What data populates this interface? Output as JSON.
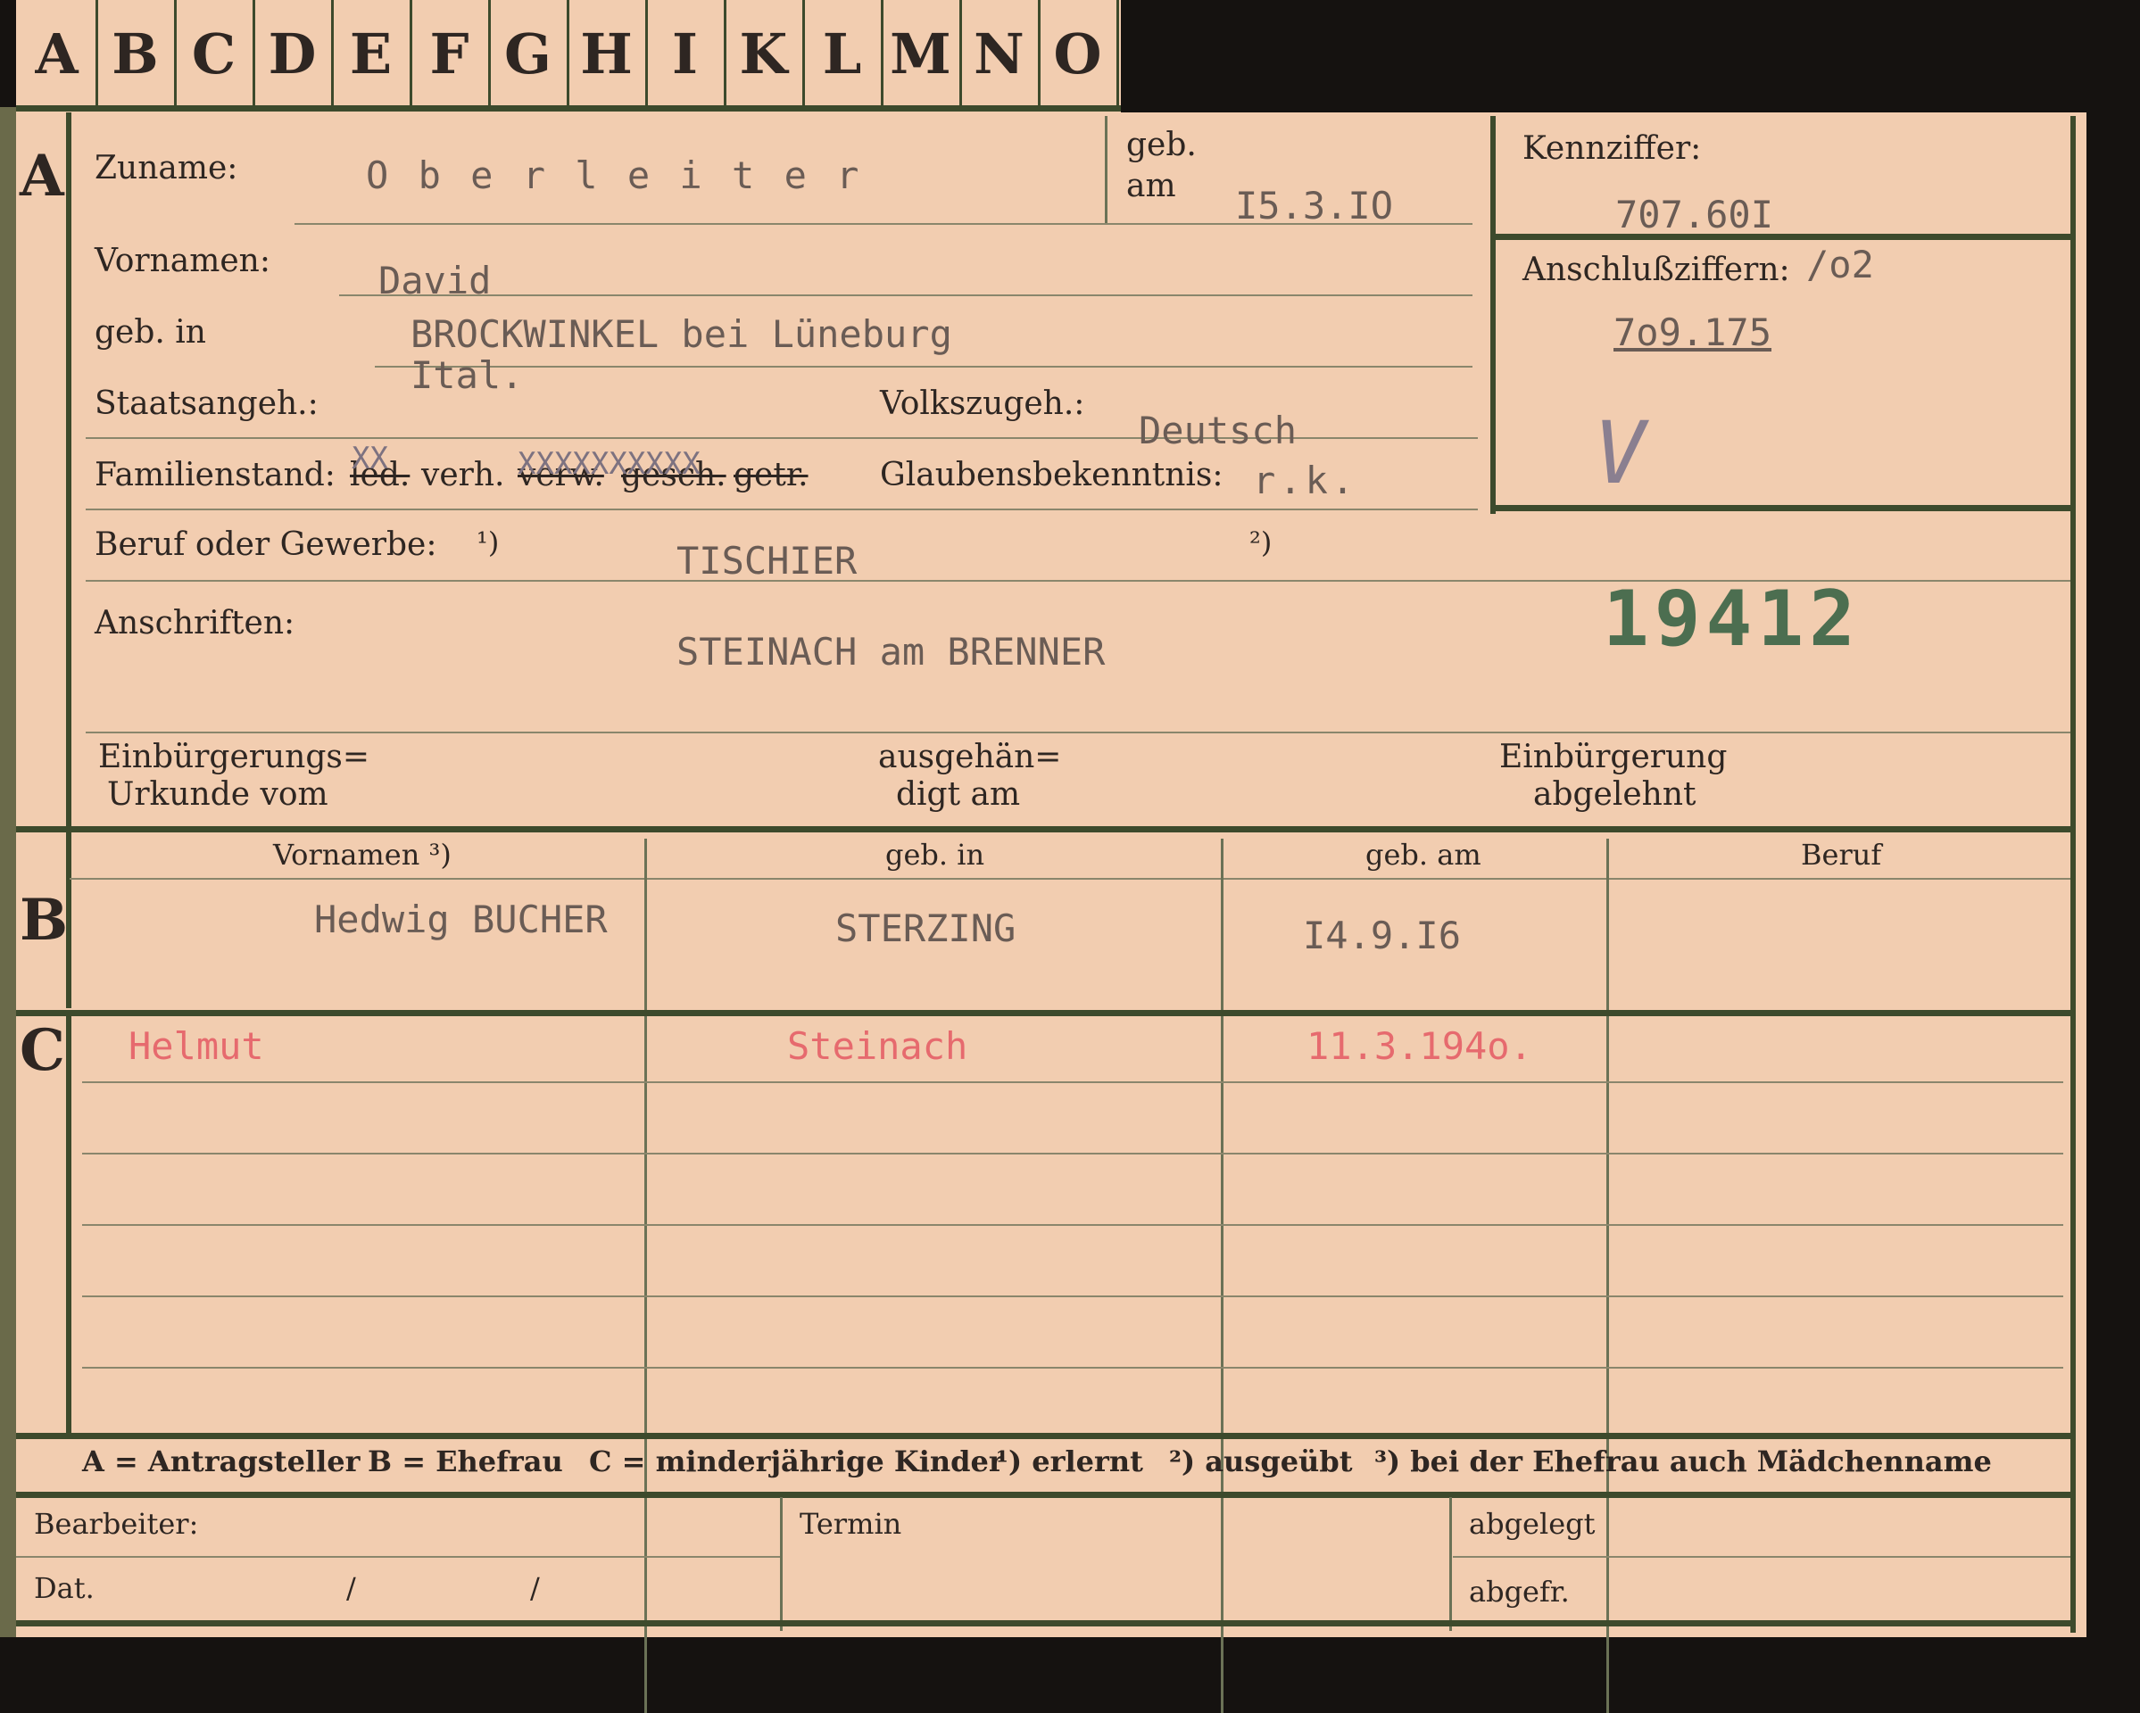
{
  "tabs": [
    "A",
    "B",
    "C",
    "D",
    "E",
    "F",
    "G",
    "H",
    "I",
    "K",
    "L",
    "M",
    "N",
    "O"
  ],
  "sections": {
    "a": "A",
    "b": "B",
    "c": "C"
  },
  "labels": {
    "zuname": "Zuname:",
    "geb": "geb.",
    "am": "am",
    "kennziffer": "Kennziffer:",
    "vornamen": "Vornamen:",
    "anschlussziffern": "Anschlußziffern:",
    "geb_in": "geb. in",
    "staatsangeh": "Staatsangeh.:",
    "volkszugeh": "Volkszugeh.:",
    "familienstand": "Familienstand:",
    "led": "led.",
    "verh": "verh.",
    "verw": "verw.",
    "gesch": "gesch.",
    "getr": "getr.",
    "glaubensbekenntnis": "Glaubensbekenntnis:",
    "beruf": "Beruf oder Gewerbe:",
    "fn1": "¹)",
    "fn2": "²)",
    "anschriften": "Anschriften:",
    "einb1": "Einbürgerungs=",
    "einb2": "Urkunde vom",
    "ausg1": "ausgehän=",
    "ausg2": "digt am",
    "abgel1": "Einbürgerung",
    "abgel2": "abgelehnt"
  },
  "values": {
    "zuname": "O b e r l e i t e r",
    "geb_am": "I5.3.IO",
    "kennziffer": "707.60I",
    "vornamen": "David",
    "anschlussziffern_suffix": "/o2",
    "anschlussziffern": "7o9.175",
    "geb_in": "BROCKWINKEL bei Lüneburg",
    "staatsangeh": "Ital.",
    "volkszugeh": "Deutsch",
    "familienstand_marks": "XX",
    "familienstand_marks2": "XXXXXXXXXX",
    "glaube": "r.k.",
    "beruf": "TISCHIER",
    "anschrift": "STEINACH am BRENNER",
    "stamp": "19412",
    "checkmark": "V"
  },
  "section_b": {
    "headers": [
      "Vornamen ³)",
      "geb. in",
      "geb. am",
      "Beruf"
    ],
    "row": [
      "Hedwig BUCHER",
      "STERZING",
      "I4.9.I6",
      ""
    ]
  },
  "section_c": {
    "rows": [
      [
        "Helmut",
        "Steinach",
        "11.3.194o.",
        ""
      ]
    ]
  },
  "legend": {
    "a": "A = Antragsteller",
    "b": "B = Ehefrau",
    "c": "C = minderjährige Kinder",
    "n1": "¹) erlernt",
    "n2": "²) ausgeübt",
    "n3": "³) bei der Ehefrau auch Mädchenname"
  },
  "footer": {
    "bearbeiter": "Bearbeiter:",
    "dat": "Dat.",
    "slash1": "/",
    "slash2": "/",
    "termin": "Termin",
    "abgelegt": "abgelegt",
    "abgefr": "abgefr."
  }
}
